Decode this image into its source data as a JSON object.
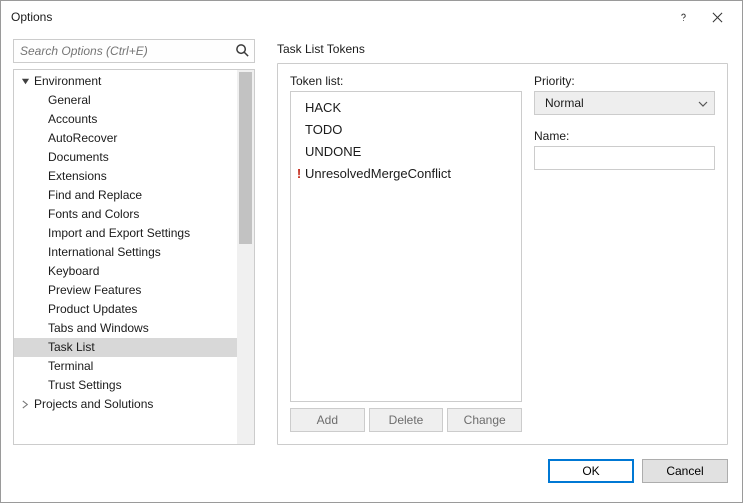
{
  "window": {
    "title": "Options"
  },
  "search": {
    "placeholder": "Search Options (Ctrl+E)"
  },
  "tree": {
    "groups": [
      {
        "label": "Environment",
        "expanded": true,
        "children": [
          {
            "label": "General"
          },
          {
            "label": "Accounts"
          },
          {
            "label": "AutoRecover"
          },
          {
            "label": "Documents"
          },
          {
            "label": "Extensions"
          },
          {
            "label": "Find and Replace"
          },
          {
            "label": "Fonts and Colors"
          },
          {
            "label": "Import and Export Settings"
          },
          {
            "label": "International Settings"
          },
          {
            "label": "Keyboard"
          },
          {
            "label": "Preview Features"
          },
          {
            "label": "Product Updates"
          },
          {
            "label": "Tabs and Windows"
          },
          {
            "label": "Task List",
            "selected": true
          },
          {
            "label": "Terminal"
          },
          {
            "label": "Trust Settings"
          }
        ]
      },
      {
        "label": "Projects and Solutions",
        "expanded": false,
        "children": []
      }
    ]
  },
  "panel": {
    "title": "Task List Tokens",
    "token_list_label": "Token list:",
    "tokens": [
      {
        "label": "HACK",
        "priority": "Normal"
      },
      {
        "label": "TODO",
        "priority": "Normal"
      },
      {
        "label": "UNDONE",
        "priority": "Normal"
      },
      {
        "label": "UnresolvedMergeConflict",
        "priority": "High",
        "icon": "!"
      }
    ],
    "buttons": {
      "add": "Add",
      "delete": "Delete",
      "change": "Change"
    },
    "priority_label": "Priority:",
    "priority_value": "Normal",
    "name_label": "Name:",
    "name_value": ""
  },
  "footer": {
    "ok": "OK",
    "cancel": "Cancel"
  }
}
